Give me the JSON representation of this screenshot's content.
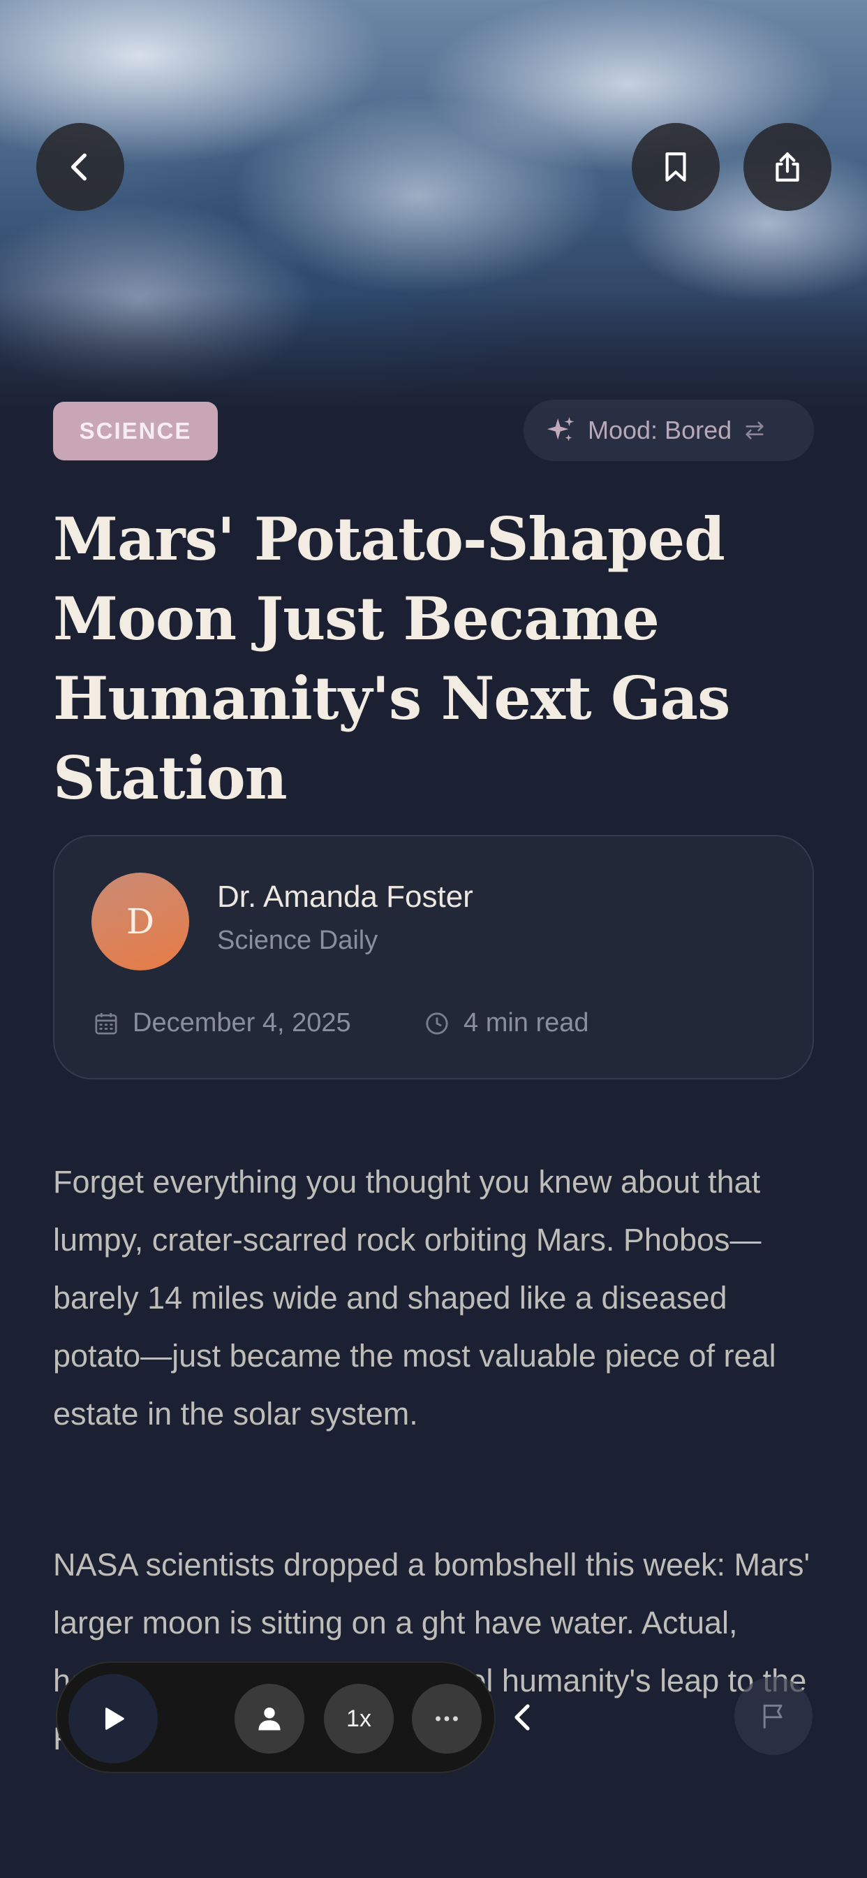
{
  "header": {
    "back_icon": "chevron-left-icon",
    "bookmark_icon": "bookmark-icon",
    "share_icon": "share-icon"
  },
  "article": {
    "category": "SCIENCE",
    "mood_label": "Mood: Bored",
    "title": "Mars' Potato-Shaped Moon Just Became Humanity's Next Gas Station",
    "author": {
      "initial": "D",
      "name": "Dr. Amanda Foster",
      "publication": "Science Daily"
    },
    "date": "December 4, 2025",
    "read_time": "4 min read",
    "paragraphs": [
      "Forget everything you thought you knew about that lumpy, crater-scarred rock orbiting Mars. Phobos—barely 14 miles wide and shaped like a diseased potato—just became the most valuable piece of real estate in the solar system.",
      "NASA scientists dropped a bombshell this week: Mars' larger moon is sitting on a ght have water. Actual, harvestable H2O that could fuel humanity's leap to the Red Planet."
    ]
  },
  "player": {
    "speed_label": "1x"
  },
  "colors": {
    "background": "#1b2032",
    "category_chip": "#c9a6b6",
    "avatar_gradient_end": "#e77b45"
  }
}
